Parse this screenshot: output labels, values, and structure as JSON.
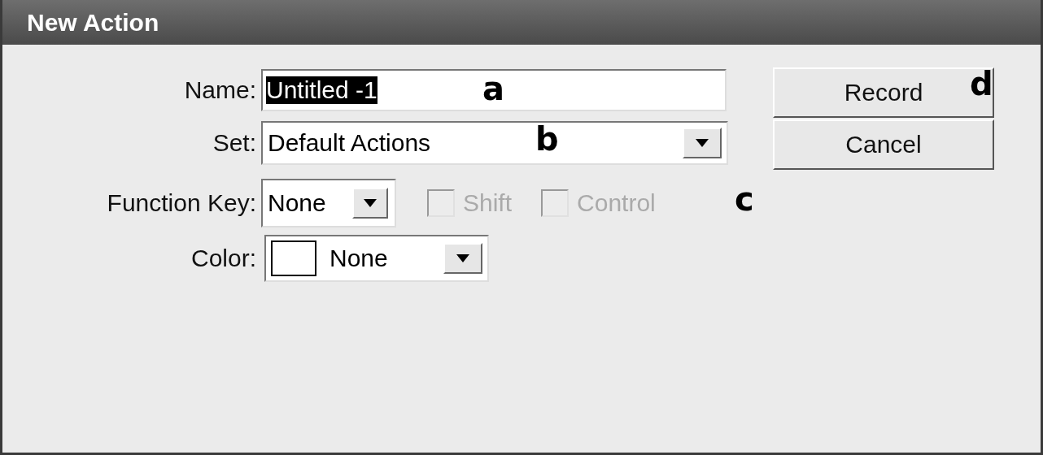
{
  "window": {
    "title": "New Action"
  },
  "name": {
    "label": "Name:",
    "value": "Untitled -1",
    "text_selected": true,
    "annotation": "a"
  },
  "set": {
    "label": "Set:",
    "value": "Default Actions",
    "annotation": "b"
  },
  "function_key": {
    "label": "Function Key:",
    "value": "None",
    "annotation": "c",
    "options": [
      {
        "label": "Shift",
        "checked": false,
        "disabled": true
      },
      {
        "label": "Control",
        "checked": false,
        "disabled": true
      }
    ]
  },
  "color": {
    "label": "Color:",
    "value": "None"
  },
  "buttons": [
    {
      "label": "Record",
      "annotation": "d"
    },
    {
      "label": "Cancel"
    }
  ]
}
